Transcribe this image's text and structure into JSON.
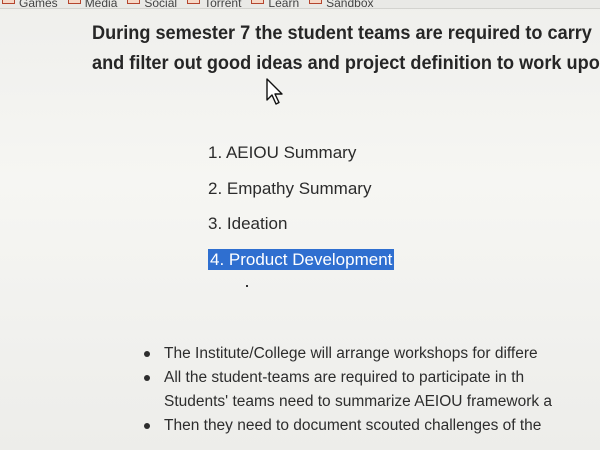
{
  "bookmarks": [
    {
      "label": "Games",
      "icon": "bookmark-folder-icon"
    },
    {
      "label": "Media",
      "icon": "bookmark-folder-icon"
    },
    {
      "label": "Social",
      "icon": "bookmark-folder-icon"
    },
    {
      "label": "Torrent",
      "icon": "bookmark-folder-icon"
    },
    {
      "label": "Learn",
      "icon": "bookmark-folder-icon"
    },
    {
      "label": "Sandbox",
      "icon": "bookmark-folder-icon"
    }
  ],
  "intro": {
    "line1": "During semester 7 the student teams are required to carry",
    "line2": "and filter out good ideas and project definition to work upo"
  },
  "steps": [
    "1. AEIOU Summary",
    "2. Empathy Summary",
    "3. Ideation",
    "4. Product Development"
  ],
  "bullets": [
    "The Institute/College will arrange workshops for differe",
    "All the student-teams are required to participate in th",
    "Students' teams need to summarize AEIOU framework a",
    "Then they need to document scouted challenges of the"
  ],
  "colors": {
    "selection": "#2f6fd0",
    "bookmark_icon": "#b4452e"
  }
}
